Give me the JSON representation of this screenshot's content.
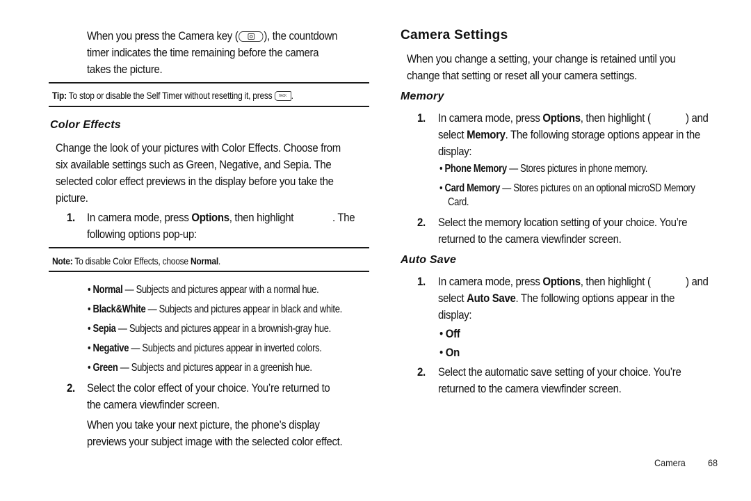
{
  "left_column": {
    "intro": {
      "line1_pre": "When you press the Camera key (",
      "line1_post": "), the countdown",
      "line2": "timer indicates the time remaining before the camera",
      "line3": "takes the picture.",
      "camera_key_icon": "camera-key-icon"
    },
    "tip": {
      "label": "Tip:",
      "text": " To stop or disable the Self Timer without resetting it, press ",
      "end": ".",
      "back_key_icon": "back-key-icon",
      "back_key_text": "BACK"
    },
    "color_effects": {
      "heading": "Color Effects",
      "paragraph": [
        "Change the look of your pictures with Color Effects. Choose from",
        "six available settings such as Green, Negative, and Sepia. The",
        "selected color effect previews in the display before you take the",
        "picture."
      ],
      "step1": {
        "number": "1.",
        "pre": "In camera mode, press ",
        "bold": "Options",
        "post": ", then highlight",
        "end": ". The",
        "line2": "following options pop-up:"
      },
      "note": {
        "label": "Note:",
        "text": " To disable Color Effects, choose ",
        "bold": "Normal",
        "end": "."
      },
      "options": [
        {
          "name": "Normal",
          "desc": " — Subjects and pictures appear with a normal hue."
        },
        {
          "name": "Black&White",
          "desc": " — Subjects and pictures appear in black and white."
        },
        {
          "name": "Sepia",
          "desc": " — Subjects and pictures appear in a brownish-gray hue."
        },
        {
          "name": "Negative",
          "desc": " — Subjects and pictures appear in inverted colors."
        },
        {
          "name": "Green",
          "desc": " — Subjects and pictures appear in a greenish hue."
        }
      ],
      "step2": {
        "number": "2.",
        "line1": "Select the color effect of your choice. You’re returned to",
        "line2": "the camera viewfinder screen."
      },
      "closing": [
        "When you take your next picture, the phone’s display",
        "previews your subject image with the selected color effect."
      ]
    }
  },
  "right_column": {
    "camera_settings": {
      "heading": "Camera Settings",
      "paragraph": [
        "When you change a setting, your change is retained until you",
        "change that setting or reset all your camera settings."
      ]
    },
    "memory": {
      "heading": "Memory",
      "step1": {
        "number": "1.",
        "pre": "In camera mode, press ",
        "bold": "Options",
        "post": ", then highlight (",
        "end": ") and",
        "line2_pre": "select ",
        "line2_bold": "Memory",
        "line2_post": ". The following storage options appear in the",
        "line3": "display:"
      },
      "options": [
        {
          "name": "Phone Memory",
          "desc": " — Stores pictures in phone memory.",
          "cont": ""
        },
        {
          "name": "Card Memory",
          "desc": " — Stores pictures on an optional microSD Memory",
          "cont": "Card."
        }
      ],
      "step2": {
        "number": "2.",
        "line1": "Select the memory location setting of your choice. You’re",
        "line2": "returned to the camera viewfinder screen."
      }
    },
    "auto_save": {
      "heading": "Auto Save",
      "step1": {
        "number": "1.",
        "pre": "In camera mode, press ",
        "bold": "Options",
        "post": ", then highlight (",
        "end": ") and",
        "line2_pre": "select ",
        "line2_bold": "Auto Save",
        "line2_post": ". The following options appear in the",
        "line3": "display:"
      },
      "options": [
        "Off",
        "On"
      ],
      "step2": {
        "number": "2.",
        "line1": "Select the automatic save setting of your choice. You’re",
        "line2": "returned to the camera viewfinder screen."
      }
    }
  },
  "footer": {
    "section": "Camera",
    "page_number": "68"
  }
}
